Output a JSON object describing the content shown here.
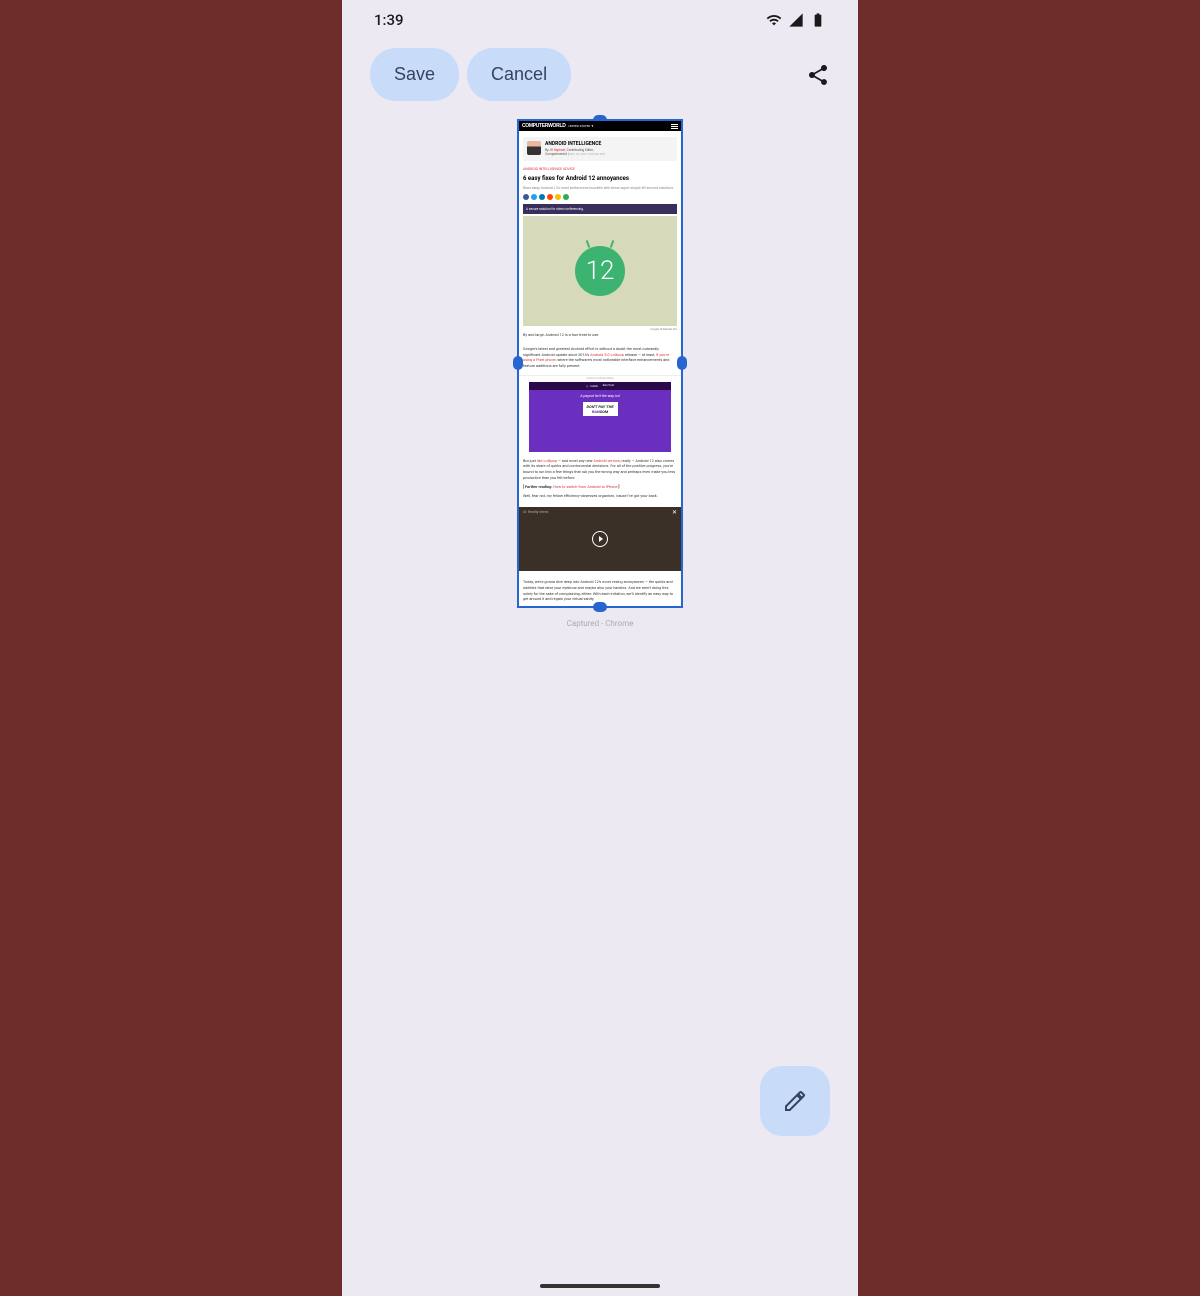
{
  "status": {
    "time": "1:39"
  },
  "toolbar": {
    "save": "Save",
    "cancel": "Cancel"
  },
  "article": {
    "site_name": "COMPUTERWORLD",
    "region": "UNITED STATES",
    "column": "ANDROID INTELLIGENCE",
    "by": "By ",
    "author": "JR Raphael",
    "author_title": ", Contributing Editor,",
    "publication": "Computerworld",
    "date": "DEC 10, 2021 3:00 AM PST",
    "breadcrumb": "ANDROID INTELLIGENCE ADVICE",
    "headline": "6 easy fixes for Android 12 annoyances",
    "dek": "Blast away Android 12's most bothersome buzzkills with these super-simple 60-second solutions.",
    "ad1": "A secure solution for video conferencing.",
    "hero_credit": "Google/JR Raphael, IDG",
    "p1": "By and large, Android 12 is a true treat to use.",
    "p2a": "Google's latest and greatest Android effort is without a doubt the most outwardly significant Android update since 2014's ",
    "link1": "Android 5.0 Lollipop",
    "p2b": " release — at least, ",
    "link2": "if you're using a Pixel phone",
    "p2c": ", where the software's most noticeable interface enhancements and feature additions are fully present.",
    "content_break": "Content Continues Below",
    "ad2_brand": "rubrik",
    "ad2_tag": "Zero Trust",
    "ad2_head": "A payout isn't the way out",
    "ad2_line1": "DON'T PAY THE",
    "ad2_line2a": "RAN",
    "ad2_line2b": "SOM",
    "p3a": "But just ",
    "link3": "like Lollipop",
    "p3b": " — and most any new ",
    "link4": "Android version",
    "p3c": ", really — Android 12 also comes with its share of quirks and controversial decisions. For all of the positive progress, you're bound to run into a few things that rub you the wrong way and perhaps even make you less productive than you felt before.",
    "further_label": "[ Further reading: ",
    "further_link": "How to switch from Android to iPhone",
    "further_close": " ]",
    "p4": "Well, fear not, my fellow efficiency-obsessed organism, 'cause I've got your back.",
    "video_title": "AI: Reality check",
    "p5": "Today, we're gonna dive deep into Android 12's most vexing annoyances — the quirks and oddities that raise your eyebrow and maybe also your hackles. And we aren't doing this solely for the sake of complaining, either: With each irritation, we'll identify an easy way to get around it and regain your virtual sanity.",
    "page_label": "Captured - Chrome"
  }
}
